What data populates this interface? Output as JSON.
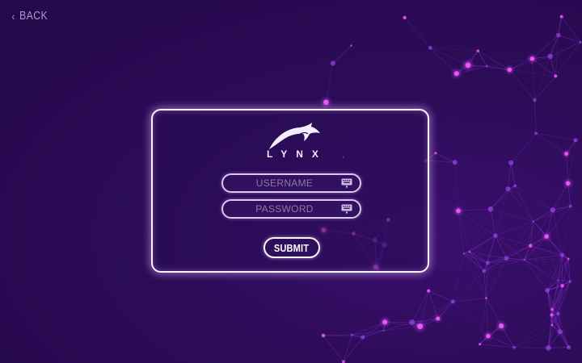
{
  "back": {
    "label": "BACK",
    "icon": "chevron-left-icon"
  },
  "logo": {
    "text": "LYNX",
    "icon": "lynx-cat-logo-icon"
  },
  "form": {
    "username": {
      "placeholder": "USERNAME",
      "value": "",
      "icon": "keyboard-icon"
    },
    "password": {
      "placeholder": "PASSWORD",
      "value": "",
      "icon": "keyboard-icon"
    },
    "submit_label": "SUBMIT"
  },
  "colors": {
    "background": "#2a0b52",
    "card_border": "#fbf6ff",
    "network_accent": "#d63cf2",
    "text_muted": "#a99bc4"
  }
}
